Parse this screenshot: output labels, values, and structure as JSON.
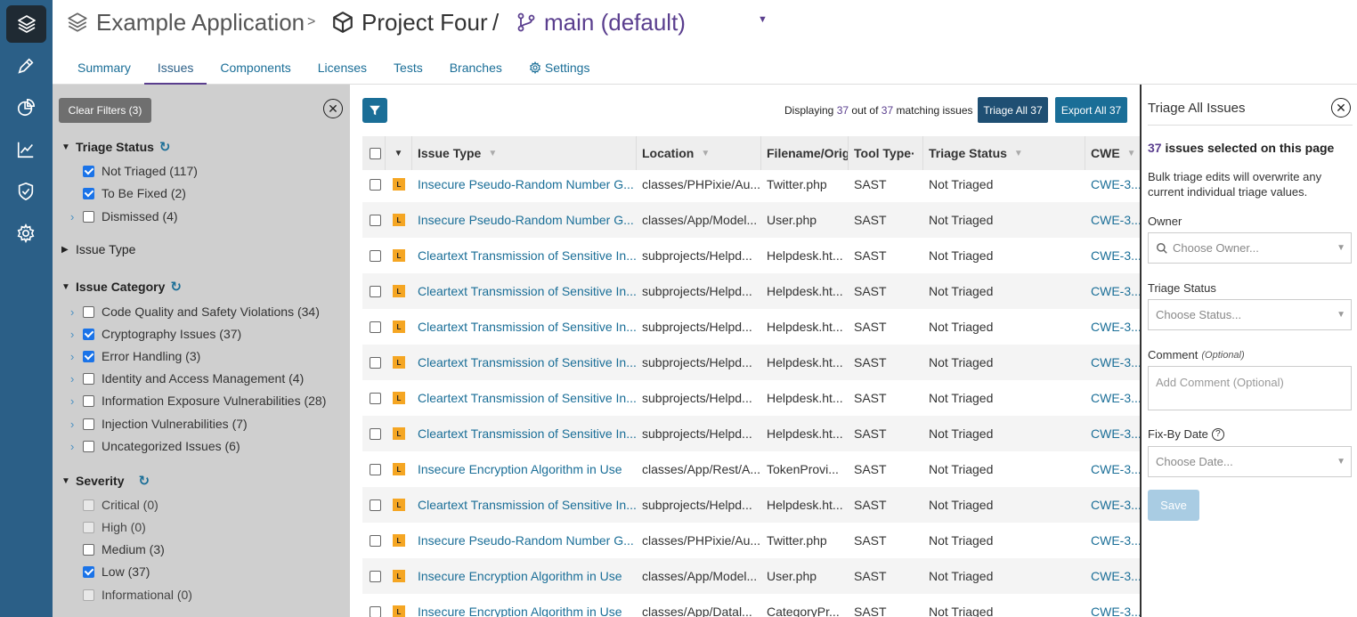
{
  "header": {
    "app_name": "Example Application",
    "separator1": ">",
    "project": "Project Four",
    "separator2": "/",
    "branch": "main (default)"
  },
  "tabs": [
    {
      "label": "Summary"
    },
    {
      "label": "Issues"
    },
    {
      "label": "Components"
    },
    {
      "label": "Licenses"
    },
    {
      "label": "Tests"
    },
    {
      "label": "Branches"
    },
    {
      "label": "Settings"
    }
  ],
  "filters": {
    "clear_label": "Clear Filters (3)",
    "triage_status": {
      "title": "Triage Status",
      "items": [
        {
          "label": "Not Triaged (117)",
          "checked": true
        },
        {
          "label": "To Be Fixed (2)",
          "checked": true
        },
        {
          "label": "Dismissed (4)",
          "checked": false
        }
      ]
    },
    "issue_type": {
      "title": "Issue Type"
    },
    "issue_category": {
      "title": "Issue Category",
      "items": [
        {
          "label": "Code Quality and Safety Violations (34)",
          "checked": false
        },
        {
          "label": "Cryptography Issues (37)",
          "checked": true
        },
        {
          "label": "Error Handling (3)",
          "checked": true
        },
        {
          "label": "Identity and Access Management (4)",
          "checked": false
        },
        {
          "label": "Information Exposure Vulnerabilities (28)",
          "checked": false
        },
        {
          "label": "Injection Vulnerabilities (7)",
          "checked": false
        },
        {
          "label": "Uncategorized Issues (6)",
          "checked": false
        }
      ]
    },
    "severity": {
      "title": "Severity",
      "items": [
        {
          "label": "Critical (0)",
          "checked": false
        },
        {
          "label": "High (0)",
          "checked": false
        },
        {
          "label": "Medium (3)",
          "checked": false
        },
        {
          "label": "Low (37)",
          "checked": true
        },
        {
          "label": "Informational (0)",
          "checked": false
        }
      ]
    }
  },
  "table": {
    "display_prefix": "Displaying",
    "display_count": "37",
    "display_mid": "out of",
    "display_total": "37",
    "display_suffix": "matching issues",
    "triage_all_label": "Triage All 37",
    "export_all_label": "Export All 37",
    "severity_badge": "L",
    "columns": [
      "Issue Type",
      "Location",
      "Filename/Orig",
      "Tool Type·",
      "Triage Status",
      "CWE"
    ],
    "rows": [
      {
        "issue": "Insecure Pseudo-Random Number G...",
        "location": "classes/PHPixie/Au...",
        "filename": "Twitter.php",
        "tool": "SAST",
        "status": "Not Triaged",
        "cwe": "CWE-3..."
      },
      {
        "issue": "Insecure Pseudo-Random Number G...",
        "location": "classes/App/Model...",
        "filename": "User.php",
        "tool": "SAST",
        "status": "Not Triaged",
        "cwe": "CWE-3..."
      },
      {
        "issue": "Cleartext Transmission of Sensitive In...",
        "location": "subprojects/Helpd...",
        "filename": "Helpdesk.ht...",
        "tool": "SAST",
        "status": "Not Triaged",
        "cwe": "CWE-3..."
      },
      {
        "issue": "Cleartext Transmission of Sensitive In...",
        "location": "subprojects/Helpd...",
        "filename": "Helpdesk.ht...",
        "tool": "SAST",
        "status": "Not Triaged",
        "cwe": "CWE-3..."
      },
      {
        "issue": "Cleartext Transmission of Sensitive In...",
        "location": "subprojects/Helpd...",
        "filename": "Helpdesk.ht...",
        "tool": "SAST",
        "status": "Not Triaged",
        "cwe": "CWE-3..."
      },
      {
        "issue": "Cleartext Transmission of Sensitive In...",
        "location": "subprojects/Helpd...",
        "filename": "Helpdesk.ht...",
        "tool": "SAST",
        "status": "Not Triaged",
        "cwe": "CWE-3..."
      },
      {
        "issue": "Cleartext Transmission of Sensitive In...",
        "location": "subprojects/Helpd...",
        "filename": "Helpdesk.ht...",
        "tool": "SAST",
        "status": "Not Triaged",
        "cwe": "CWE-3..."
      },
      {
        "issue": "Cleartext Transmission of Sensitive In...",
        "location": "subprojects/Helpd...",
        "filename": "Helpdesk.ht...",
        "tool": "SAST",
        "status": "Not Triaged",
        "cwe": "CWE-3..."
      },
      {
        "issue": "Insecure Encryption Algorithm in Use",
        "location": "classes/App/Rest/A...",
        "filename": "TokenProvi...",
        "tool": "SAST",
        "status": "Not Triaged",
        "cwe": "CWE-3..."
      },
      {
        "issue": "Cleartext Transmission of Sensitive In...",
        "location": "subprojects/Helpd...",
        "filename": "Helpdesk.ht...",
        "tool": "SAST",
        "status": "Not Triaged",
        "cwe": "CWE-3..."
      },
      {
        "issue": "Insecure Pseudo-Random Number G...",
        "location": "classes/PHPixie/Au...",
        "filename": "Twitter.php",
        "tool": "SAST",
        "status": "Not Triaged",
        "cwe": "CWE-3..."
      },
      {
        "issue": "Insecure Encryption Algorithm in Use",
        "location": "classes/App/Model...",
        "filename": "User.php",
        "tool": "SAST",
        "status": "Not Triaged",
        "cwe": "CWE-3..."
      },
      {
        "issue": "Insecure Encryption Algorithm in Use",
        "location": "classes/App/Datal...",
        "filename": "CategoryPr...",
        "tool": "SAST",
        "status": "Not Triaged",
        "cwe": "CWE-3..."
      }
    ]
  },
  "triage": {
    "title": "Triage All Issues",
    "selected_count": "37",
    "selected_text": "issues selected on this page",
    "note": "Bulk triage edits will overwrite any current individual triage values.",
    "owner_label": "Owner",
    "owner_placeholder": "Choose Owner...",
    "status_label": "Triage Status",
    "status_placeholder": "Choose Status...",
    "comment_label": "Comment",
    "comment_optional": "(Optional)",
    "comment_placeholder": "Add Comment (Optional)",
    "fixby_label": "Fix-By Date",
    "fixby_placeholder": "Choose Date...",
    "save_label": "Save"
  },
  "colors": {
    "nav_bg": "#2b5f87",
    "accent_link": "#1a6e97",
    "branch_purple": "#5a3e8e",
    "severity_low": "#f5a623"
  }
}
